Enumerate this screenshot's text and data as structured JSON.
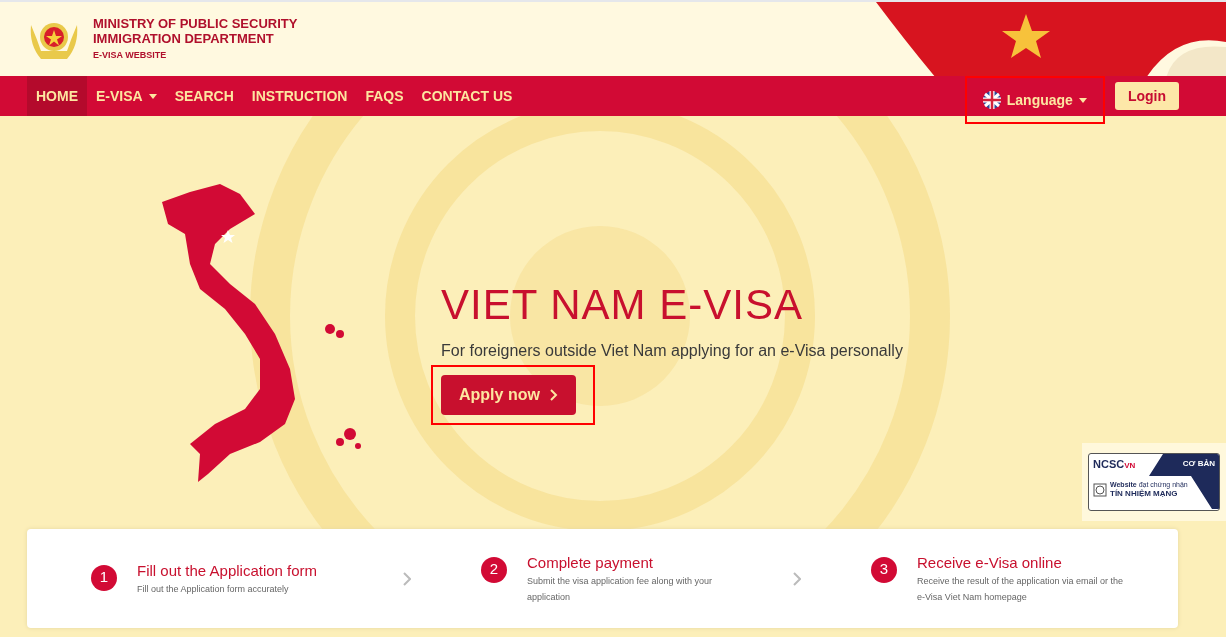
{
  "header": {
    "lines": [
      "MINISTRY OF PUBLIC SECURITY",
      "IMMIGRATION DEPARTMENT"
    ],
    "subtitle": "E-VISA WEBSITE"
  },
  "nav": {
    "items": [
      {
        "label": "HOME",
        "selected": true,
        "kind": "link"
      },
      {
        "label": "E-VISA",
        "selected": false,
        "kind": "dropdown"
      },
      {
        "label": "SEARCH",
        "selected": false,
        "kind": "link"
      },
      {
        "label": "INSTRUCTION",
        "selected": false,
        "kind": "link"
      },
      {
        "label": "FAQS",
        "selected": false,
        "kind": "link"
      },
      {
        "label": "CONTACT US",
        "selected": false,
        "kind": "link"
      }
    ],
    "language": "Language",
    "login": "Login"
  },
  "hero": {
    "title": "VIET NAM E-VISA",
    "subtitle": "For foreigners outside Viet Nam applying for an e-Visa personally",
    "button": "Apply now"
  },
  "badge": {
    "brand": "NCSC",
    "country": "VN",
    "level": "CƠ BẢN",
    "line1": "Website",
    "line1_small": "đạt chứng nhận",
    "line2": "TÍN NHIỆM MẠNG"
  },
  "steps": [
    {
      "number": "1",
      "title": "Fill out the Application form",
      "description": "Fill out the Application form accurately"
    },
    {
      "number": "2",
      "title": "Complete payment",
      "description": "Submit the visa application fee along with your application"
    },
    {
      "number": "3",
      "title": "Receive e-Visa online",
      "description": "Receive the result of the application via email or the e-Visa Viet Nam homepage"
    }
  ]
}
